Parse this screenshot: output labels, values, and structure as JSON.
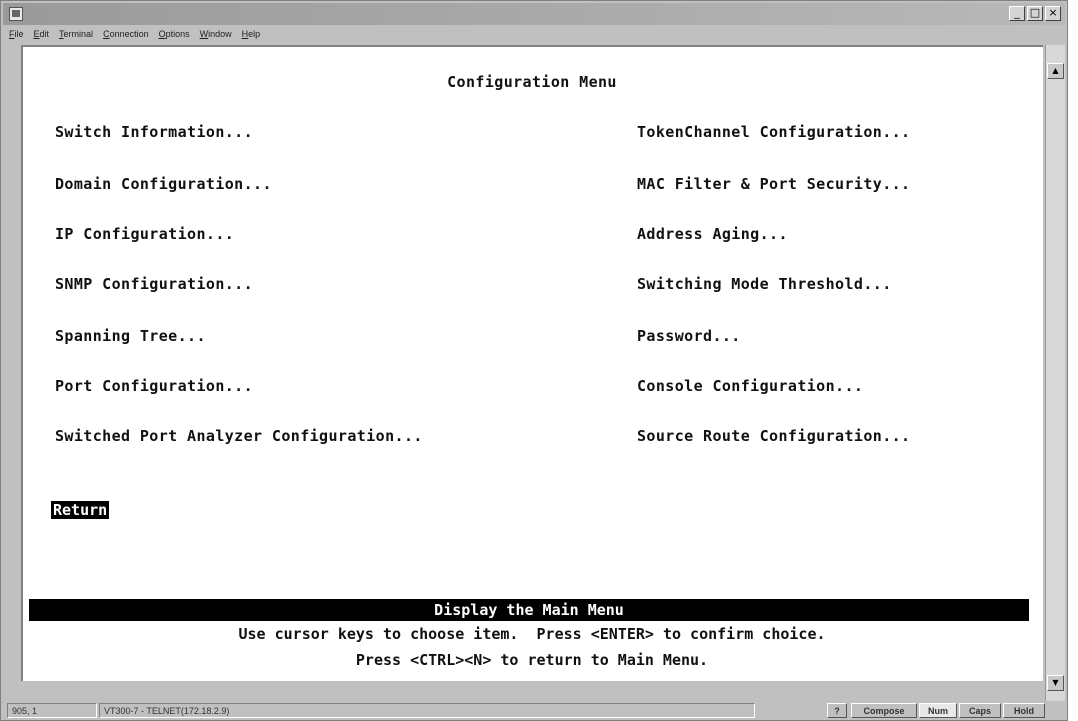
{
  "menubar": {
    "items": [
      "File",
      "Edit",
      "Terminal",
      "Connection",
      "Options",
      "Window",
      "Help"
    ]
  },
  "window_buttons": {
    "minimize": "_",
    "maximize": "□",
    "close": "×"
  },
  "screen": {
    "title": "Configuration Menu",
    "left_items": [
      "Switch Information...",
      "Domain Configuration...",
      "IP Configuration...",
      "SNMP Configuration...",
      "Spanning Tree...",
      "Port Configuration...",
      "Switched Port Analyzer Configuration..."
    ],
    "right_items": [
      "TokenChannel Configuration...",
      "MAC Filter & Port Security...",
      "Address Aging...",
      "Switching Mode Threshold...",
      "Password...",
      "Console Configuration...",
      "Source Route Configuration..."
    ],
    "selected_item": "Return",
    "status_description": "Display the Main Menu",
    "help_line_1": "Use cursor keys to choose item.  Press <ENTER> to confirm choice.",
    "help_line_2": "Press <CTRL><N> to return to Main Menu."
  },
  "statusbar": {
    "position": "905, 1",
    "session": "VT300-7 - TELNET(172.18.2.9)",
    "help": "?",
    "compose": "Compose",
    "num": "Num",
    "caps": "Caps",
    "hold": "Hold"
  }
}
